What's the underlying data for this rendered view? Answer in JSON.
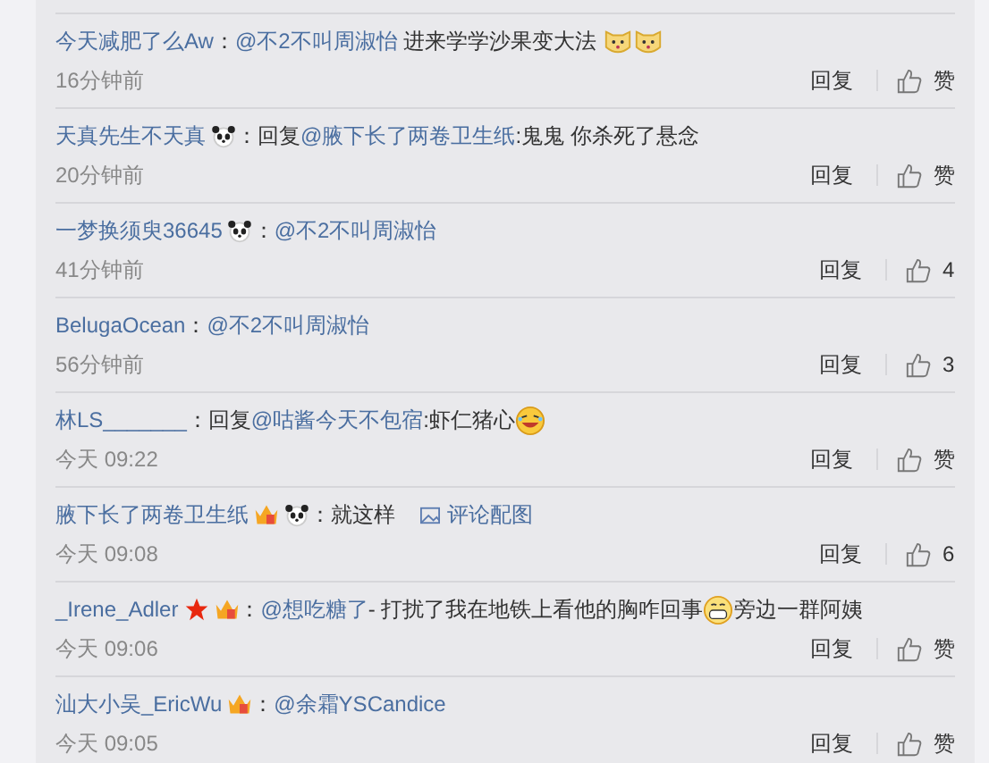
{
  "comments": [
    {
      "user": "今天减肥了么Aw",
      "content": [
        {
          "kind": "text",
          "text": "："
        },
        {
          "kind": "mention",
          "text": "@不2不叫周淑怡"
        },
        {
          "kind": "text",
          "text": " 进来学学沙果变大法 "
        },
        {
          "kind": "cat_emoji"
        },
        {
          "kind": "cat_emoji"
        }
      ],
      "time": "16分钟前",
      "reply": "回复",
      "like": "赞"
    },
    {
      "user": "天真先生不天真",
      "badges": [
        {
          "kind": "panda"
        }
      ],
      "content": [
        {
          "kind": "text",
          "text": "：回复"
        },
        {
          "kind": "mention",
          "text": "@腋下长了两卷卫生纸"
        },
        {
          "kind": "text",
          "text": ":鬼鬼 你杀死了悬念"
        }
      ],
      "time": "20分钟前",
      "reply": "回复",
      "like": "赞"
    },
    {
      "user": "一梦换须臾36645",
      "badges": [
        {
          "kind": "panda"
        }
      ],
      "content": [
        {
          "kind": "text",
          "text": "："
        },
        {
          "kind": "mention",
          "text": "@不2不叫周淑怡"
        }
      ],
      "time": "41分钟前",
      "reply": "回复",
      "like": "4"
    },
    {
      "user": "BelugaOcean",
      "content": [
        {
          "kind": "text",
          "text": "："
        },
        {
          "kind": "mention",
          "text": "@不2不叫周淑怡"
        }
      ],
      "time": "56分钟前",
      "reply": "回复",
      "like": "3"
    },
    {
      "user": "林LS_______",
      "content": [
        {
          "kind": "text",
          "text": "：回复"
        },
        {
          "kind": "mention",
          "text": "@咕酱今天不包宿"
        },
        {
          "kind": "text",
          "text": ":虾仁猪心"
        },
        {
          "kind": "laugh_emoji"
        }
      ],
      "time": "今天 09:22",
      "reply": "回复",
      "like": "赞"
    },
    {
      "user": "腋下长了两卷卫生纸",
      "badges": [
        {
          "kind": "crown"
        },
        {
          "kind": "panda"
        }
      ],
      "content": [
        {
          "kind": "text",
          "text": "：就这样"
        },
        {
          "kind": "image_link",
          "text": "评论配图"
        }
      ],
      "time": "今天 09:08",
      "reply": "回复",
      "like": "6"
    },
    {
      "user": "_Irene_Adler",
      "badges": [
        {
          "kind": "star"
        },
        {
          "kind": "crown"
        }
      ],
      "content": [
        {
          "kind": "text",
          "text": "："
        },
        {
          "kind": "mention",
          "text": "@想吃糖了"
        },
        {
          "kind": "text",
          "text": "- 打扰了我在地铁上看他的胸咋回事"
        },
        {
          "kind": "grin_emoji"
        },
        {
          "kind": "text",
          "text": "旁边一群阿姨"
        }
      ],
      "time": "今天 09:06",
      "reply": "回复",
      "like": "赞"
    },
    {
      "user": "汕大小吴_EricWu",
      "badges": [
        {
          "kind": "crown"
        }
      ],
      "content": [
        {
          "kind": "text",
          "text": "："
        },
        {
          "kind": "mention",
          "text": "@余霜YSCandice"
        }
      ],
      "time": "今天 09:05",
      "reply": "回复",
      "like": "赞"
    }
  ]
}
